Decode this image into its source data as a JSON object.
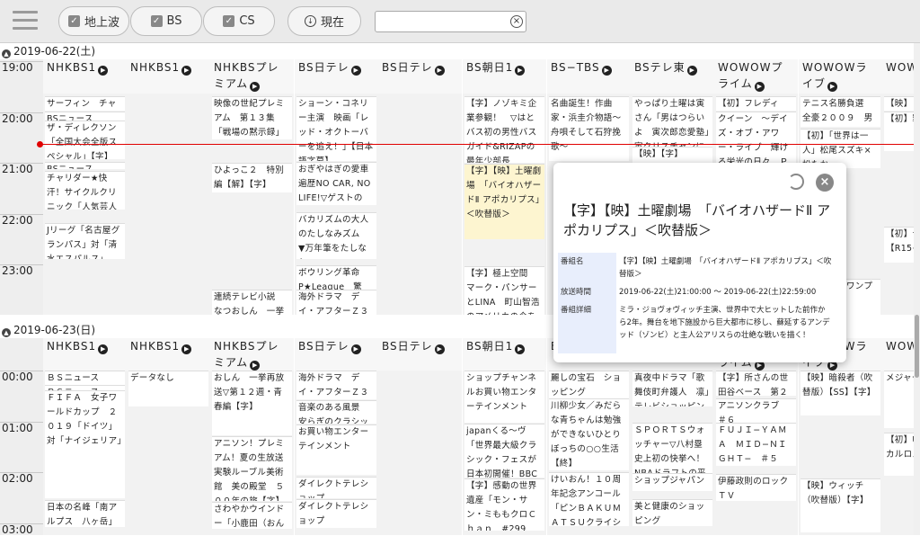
{
  "toolbar": {
    "bs_chijo": "地上波",
    "bs": "BS",
    "cs": "CS",
    "now": "現在",
    "search_value": ""
  },
  "days": [
    {
      "label": "2019-06-22(土)"
    },
    {
      "label": "2019-06-23(日)"
    }
  ],
  "times1": [
    "19:00",
    "20:00",
    "21:00",
    "22:00",
    "23:00"
  ],
  "times2": [
    "00:00",
    "01:00",
    "02:00",
    "03:00"
  ],
  "channels": [
    "NHKBS1",
    "NHKBS1",
    "NHKBSプレミアム",
    "BS日テレ",
    "BS日テレ",
    "BS朝日1",
    "BS−TBS",
    "BSテレ東",
    "WOWOWプライム",
    "WOWOWライブ",
    "WOW"
  ],
  "day1": [
    [
      "サーフィン　チャンピ",
      "BSニュース",
      "ザ・ディレクソン「全国大会全版スペシャル」【字】",
      "BSニュース",
      "チャリダー★快汗！サイクルクリニック「人気芸人２人旅　春の遠",
      "Jリーグ「名古屋グランパス」対「清水エスパルス」【デ】"
    ],
    [],
    [
      "映像の世紀プレミアム　第１３集「戦場の黙示録」【字】",
      "ひよっこ２　特別編【解】【字】",
      "連続テレビ小説　なつおしん　一挙再放送▽"
    ],
    [
      "ショーン・コネリー主演　映画「レッド・オクトーバーを追え！」【日本語字幕】",
      "おぎやはぎの愛車遍歴NO CAR, NO LIFE!▽ゲストの",
      "バカリズムの大人のたしなみズム　▼万年筆をたしなむ",
      "ボウリング革命P★League　驚",
      "海外ドラマ　デイ・アフターＺ３　第６話"
    ],
    [],
    [
      "【字】ノゾキミ企業参観！　▽はとバス初の男性バスガイド&RIZAPの最年少部長",
      "【字】【映】土曜劇場　「バイオハザードⅡ アポカリプス」＜吹替版＞",
      "【字】極上空間　マーク・パンサーとLINA　町山智浩のアメリカの今を知るTV In"
    ],
    [
      "名曲誕生！作曲家・浜圭介物語〜舟唄そして石狩挽歌〜"
    ],
    [
      "やっぱり土曜は寅さん「男はつらいよ　寅次郎恋愛塾」寅クリスチャンに宗旨替え!?",
      "【映】【字】"
    ],
    [
      "【初】フレディー・",
      "クイーン　〜デイズ・オブ・アワー・ライブ　輝ける栄光の日々　ＰＡＲＴ１"
    ],
    [
      "テニス名勝負選　全豪２００９　男子決勝",
      "【初】「世界は一人」松尾スズキ×松たか",
      "女子ゴル　ワンプロ　第"
    ],
    [
      "【映】",
      "【初】罪人【S】",
      "【初】デター【R15+指"
    ]
  ],
  "day2": [
    [
      "ＢＳニュース",
      "ＢＳニュース",
      "ＦＩＦＡ　女子ワールドカップ　２０１９「ドイツ」対「ナイジェリア」",
      "日本の名峰「南アルプス　八ヶ岳」"
    ],
    [
      "データなし"
    ],
    [
      "おしん　一挙再放送▽第１２週・青春編【字】",
      "アニソン！プレミアム！夏の生放送実験ルーブル美術館　美の殿堂　５００年の旅【字】【再】",
      "さわやかウインドー「小鹿田（おんた）焼"
    ],
    [
      "海外ドラマ　デイ・アフターＺ３　第６話",
      "音楽のある風景　安らぎのクラシック",
      "お買い物エンターテインメント",
      "ダイレクトテレショップ",
      "ダイレクトテレショップ"
    ],
    [],
    [
      "ショップチャンネルお買い物エンターテインメント",
      "japanくる〜ヴ　「世界最大級クラシック・フェスが日本初開催！BBCプロムス特",
      "【字】感動の世界遺産「モン・サン・ミももクロＣｈａｎ　#299"
    ],
    [
      "麗しの宝石　ショッピング",
      "川柳少女／みだらな青ちゃんは勉強ができないひとりぼっちの○○生活【終】",
      "けいおん！１０周年記念アンコール「ピンＢＡＫＵＭＡＴＳＵクライシス【終】▼第"
    ],
    [
      "真夜中ドラマ「歌舞伎町弁護人　凛」テレビショッピング",
      "ＳＰＯＲＴＳウォッチャー▽八村塁史上初の快挙へ！NBAドラフトの平岡を徹底解説",
      "ショップジャパン",
      "美と健康のショッピング"
    ],
    [
      "【字】所さんの世田谷ベース　第２０２回",
      "アニソンクラブ　＃６",
      "ＦＵＪＩ−ＹＡＭＡ　ＭＩＤ−ＮＩＧＨＴ−　＃５",
      "伊藤政則のロックＴＶ"
    ],
    [
      "【映】暗殺者（吹替版）【SS】【字】",
      "【映】ウィッチ（吹替版）【字】"
    ],
    [
      "メジャーUFC",
      "【初】UエキサイカルロスC"
    ]
  ],
  "popup": {
    "title": "【字】【映】土曜劇場　「バイオハザードⅡ アポカリプス」＜吹替版＞",
    "k1": "番組名",
    "v1": "【字】【映】土曜劇場　「バイオハザードⅡ アポカリプス」＜吹替版＞",
    "k2": "放送時間",
    "v2": "2019-06-22(土)21:00:00 〜 2019-06-22(土)22:59:00",
    "k3": "番組詳細",
    "v3": "ミラ・ジョヴォヴィッチ主演、世界中で大ヒットした前作から2年。舞台を地下施設から巨大都市に移し、蘇延するアンデッド（ゾンビ）と主人公アリスらの壮絶な戦いを描く！"
  },
  "colors": {
    "accent": "#e00000",
    "highlight": "#fdf5d0"
  }
}
